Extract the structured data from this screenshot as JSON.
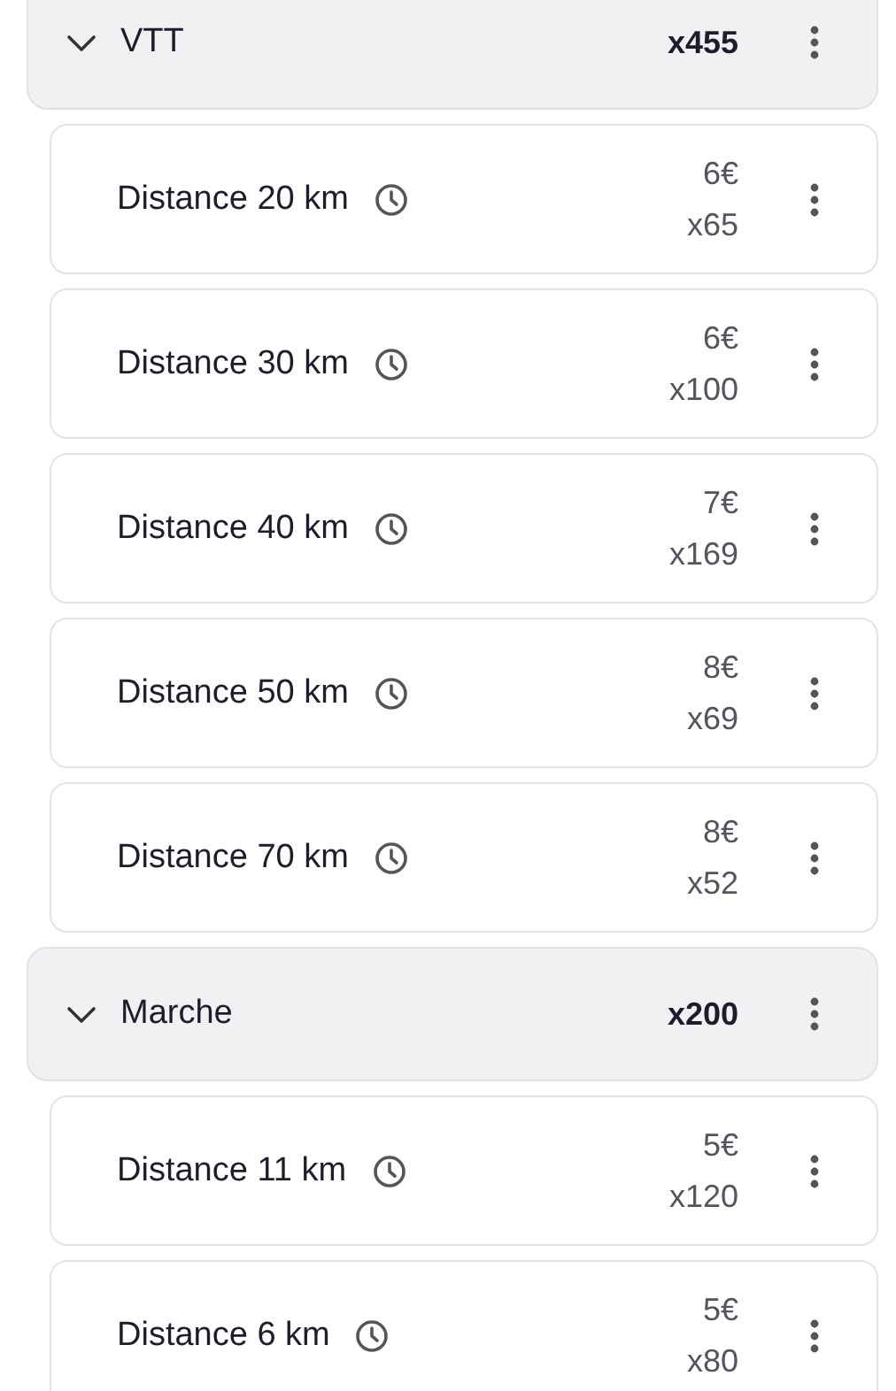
{
  "groups": [
    {
      "title": "VTT",
      "count": "x455",
      "expanded": true,
      "items": [
        {
          "name": "Distance 20 km",
          "price": "6€",
          "count": "x65"
        },
        {
          "name": "Distance 30 km",
          "price": "6€",
          "count": "x100"
        },
        {
          "name": "Distance 40 km",
          "price": "7€",
          "count": "x169"
        },
        {
          "name": "Distance 50 km",
          "price": "8€",
          "count": "x69"
        },
        {
          "name": "Distance 70 km",
          "price": "8€",
          "count": "x52"
        }
      ]
    },
    {
      "title": "Marche",
      "count": "x200",
      "expanded": true,
      "items": [
        {
          "name": "Distance 11 km",
          "price": "5€",
          "count": "x120"
        },
        {
          "name": "Distance 6 km",
          "price": "5€",
          "count": "x80"
        }
      ]
    }
  ]
}
